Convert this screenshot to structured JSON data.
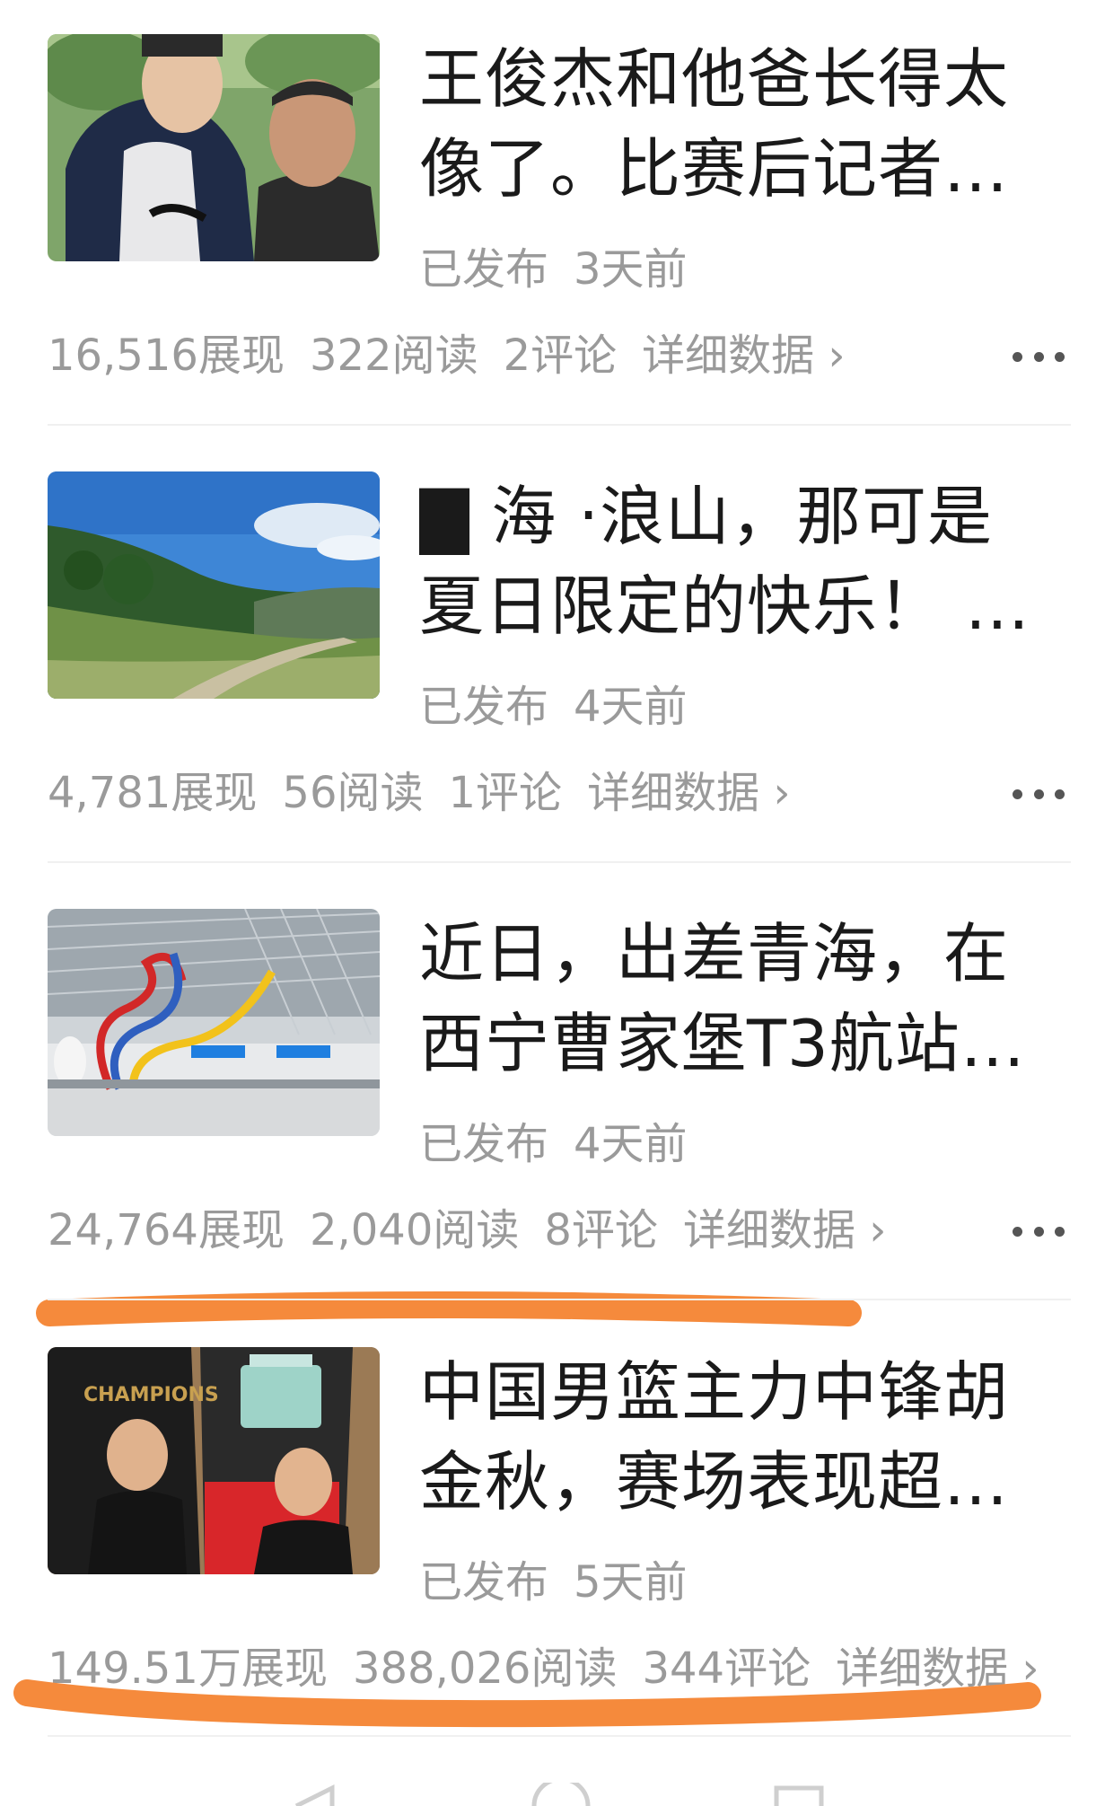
{
  "articles": [
    {
      "title_lines": [
        "王俊杰和他爸长得太",
        "像了。比赛后记者…"
      ],
      "status": "已发布",
      "time": "3天前",
      "impressions": "16,516展现",
      "reads": "322阅读",
      "comments": "2评论",
      "detail": "详细数据 ›"
    },
    {
      "title_lines": [
        "▇ 海 ‧浪山，那可是",
        "夏日限定的快乐！ …"
      ],
      "status": "已发布",
      "time": "4天前",
      "impressions": "4,781展现",
      "reads": "56阅读",
      "comments": "1评论",
      "detail": "详细数据 ›"
    },
    {
      "title_lines": [
        "近日，出差青海，在",
        "西宁曹家堡T3航站…"
      ],
      "status": "已发布",
      "time": "4天前",
      "impressions": "24,764展现",
      "reads": "2,040阅读",
      "comments": "8评论",
      "detail": "详细数据 ›"
    },
    {
      "title_lines": [
        "中国男篮主力中锋胡",
        "金秋，赛场表现超…"
      ],
      "status": "已发布",
      "time": "5天前",
      "impressions": "149.51万展现",
      "reads": "388,026阅读",
      "comments": "344评论",
      "detail": "详细数据 ›"
    }
  ],
  "colors": {
    "title": "#1a1a1a",
    "meta": "#9a9a9a",
    "highlight_stroke": "#f58a3c",
    "divider": "#f0f0f0"
  },
  "icons": [
    "more-dots-icon",
    "chevron-right-icon",
    "back-triangle-icon",
    "home-circle-icon",
    "recents-square-icon"
  ]
}
